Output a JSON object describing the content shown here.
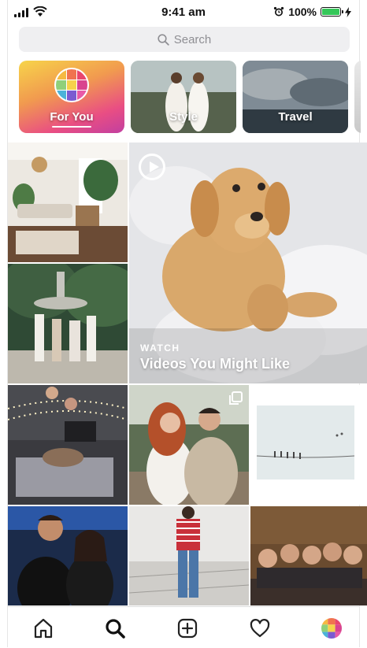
{
  "status_bar": {
    "time": "9:41 am",
    "battery": "100%",
    "battery_level": 1.0
  },
  "search": {
    "placeholder": "Search"
  },
  "categories": [
    {
      "label": "For You",
      "selected": true
    },
    {
      "label": "Style"
    },
    {
      "label": "Travel"
    }
  ],
  "feature": {
    "kicker": "WATCH",
    "title": "Videos You Might Like"
  },
  "tabs": [
    {
      "icon": "home-icon"
    },
    {
      "icon": "search-icon",
      "active": true
    },
    {
      "icon": "add-post-icon"
    },
    {
      "icon": "heart-icon"
    },
    {
      "icon": "profile-avatar"
    }
  ],
  "colors": {
    "accent_gradient_start": "#f6c04a",
    "accent_gradient_end": "#e94e83",
    "battery_green": "#35c759"
  }
}
